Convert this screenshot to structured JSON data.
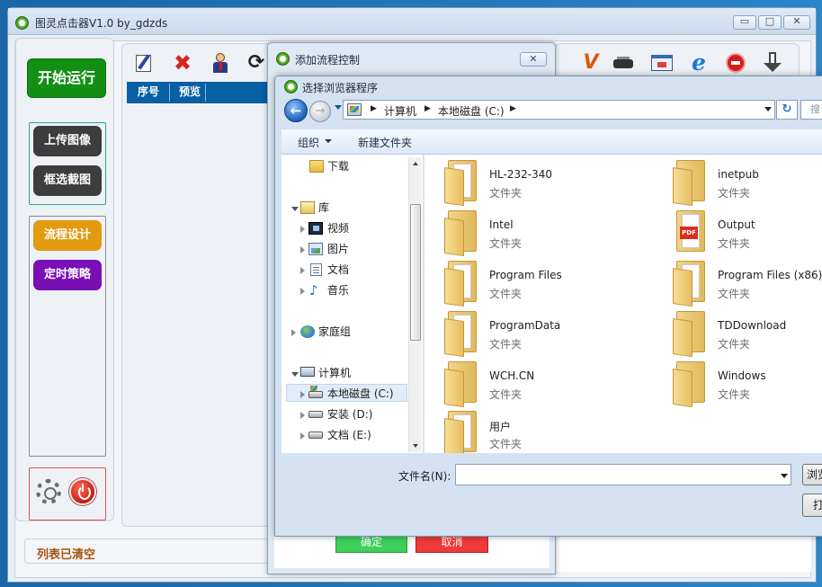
{
  "main_window": {
    "title": "图灵点击器V1.0 by_gdzds",
    "buttons": {
      "minimize": "▭",
      "maximize": "□",
      "close": "✕"
    }
  },
  "sidebar": {
    "start": "开始运行",
    "upload": "上传图像",
    "crop": "框选截图",
    "flow_design": "流程设计",
    "timer": "定时策略"
  },
  "table": {
    "columns": [
      "序号",
      "预览"
    ]
  },
  "toolbar_icons": [
    "edit-icon",
    "delete-icon",
    "user-icon",
    "refresh-icon",
    "v-icon",
    "printer-icon",
    "screen-icon",
    "ie-icon",
    "stop-icon",
    "download-icon"
  ],
  "status": "列表已清空",
  "flow_dialog": {
    "title": "添加流程控制",
    "close": "✕",
    "ok": "确定",
    "cancel": "取消"
  },
  "file_dialog": {
    "title": "选择浏览器程序",
    "breadcrumb": [
      "计算机",
      "本地磁盘 (C:)"
    ],
    "search_placeholder": "搜",
    "organize": "组织",
    "new_folder": "新建文件夹",
    "nav": [
      {
        "label": "下载",
        "icon": "folder-icon"
      },
      {
        "label": "库",
        "icon": "library-icon"
      },
      {
        "label": "视频",
        "icon": "video-icon"
      },
      {
        "label": "图片",
        "icon": "pictures-icon"
      },
      {
        "label": "文档",
        "icon": "documents-icon"
      },
      {
        "label": "音乐",
        "icon": "music-icon"
      },
      {
        "label": "家庭组",
        "icon": "homegroup-icon"
      },
      {
        "label": "计算机",
        "icon": "computer-icon"
      },
      {
        "label": "本地磁盘 (C:)",
        "icon": "c-drive-icon"
      },
      {
        "label": "安装 (D:)",
        "icon": "drive-icon"
      },
      {
        "label": "文档 (E:)",
        "icon": "drive-icon"
      }
    ],
    "files": [
      {
        "name": "HL-232-340",
        "type": "文件夹"
      },
      {
        "name": "inetpub",
        "type": "文件夹"
      },
      {
        "name": "Intel",
        "type": "文件夹"
      },
      {
        "name": "Output",
        "type": "文件夹"
      },
      {
        "name": "Program Files",
        "type": "文件夹"
      },
      {
        "name": "Program Files (x86)",
        "type": "文件夹"
      },
      {
        "name": "ProgramData",
        "type": "文件夹"
      },
      {
        "name": "TDDownload",
        "type": "文件夹"
      },
      {
        "name": "WCH.CN",
        "type": "文件夹"
      },
      {
        "name": "Windows",
        "type": "文件夹"
      },
      {
        "name": "用户",
        "type": "文件夹"
      }
    ],
    "filename_label": "文件名(N):",
    "filename_value": "",
    "browse": "浏览",
    "open": "打开"
  }
}
